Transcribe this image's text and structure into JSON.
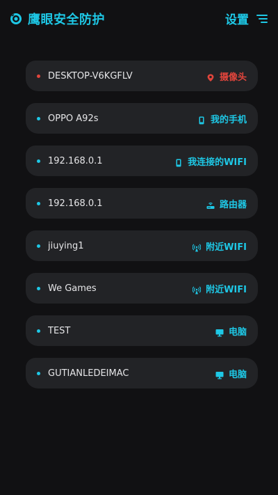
{
  "header": {
    "title": "鹰眼安全防护",
    "settings_label": "设置",
    "accent": "#1ec8e6",
    "logo_icon": "eye-shield-icon",
    "menu_icon": "filter-menu-icon"
  },
  "devices": [
    {
      "name": "DESKTOP-V6KGFLV",
      "type": "摄像头",
      "icon": "camera-pin-icon",
      "status_color": "#e2453c"
    },
    {
      "name": "OPPO A92s",
      "type": "我的手机",
      "icon": "phone-icon",
      "status_color": "#1ec8e6"
    },
    {
      "name": "192.168.0.1",
      "type": "我连接的WIFI",
      "icon": "phone-icon",
      "status_color": "#1ec8e6"
    },
    {
      "name": "192.168.0.1",
      "type": "路由器",
      "icon": "router-icon",
      "status_color": "#1ec8e6"
    },
    {
      "name": "jiuying1",
      "type": "附近WIFI",
      "icon": "antenna-icon",
      "status_color": "#1ec8e6"
    },
    {
      "name": "We Games",
      "type": "附近WIFI",
      "icon": "antenna-icon",
      "status_color": "#1ec8e6"
    },
    {
      "name": "TEST",
      "type": "电脑",
      "icon": "monitor-icon",
      "status_color": "#1ec8e6"
    },
    {
      "name": "GUTIANLEDEIMAC",
      "type": "电脑",
      "icon": "monitor-icon",
      "status_color": "#1ec8e6"
    }
  ]
}
